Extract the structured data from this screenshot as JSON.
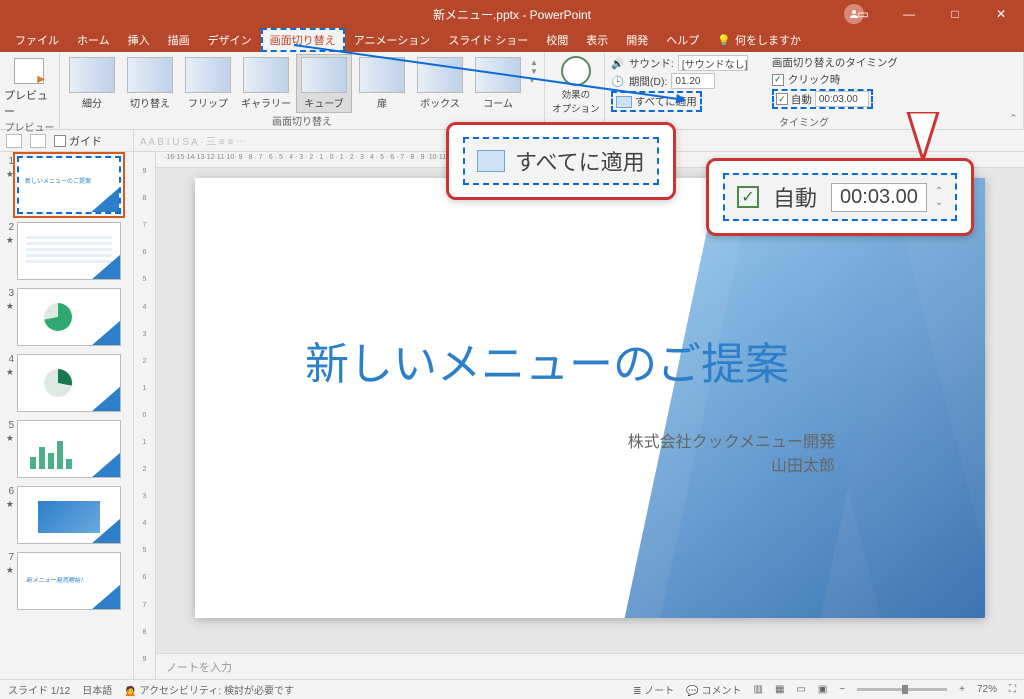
{
  "app": {
    "title": "新メニュー.pptx  -  PowerPoint"
  },
  "win": {
    "min": "—",
    "max": "□",
    "close": "✕",
    "rib": "▭"
  },
  "tabs": {
    "file": "ファイル",
    "home": "ホーム",
    "insert": "挿入",
    "draw": "描画",
    "design": "デザイン",
    "transitions": "画面切り替え",
    "animations": "アニメーション",
    "slideshow": "スライド ショー",
    "review": "校閲",
    "view": "表示",
    "dev": "開発",
    "help": "ヘルプ",
    "tell": "何をしますか"
  },
  "ribbon": {
    "preview": "プレビュー",
    "preview_grp": "プレビュー",
    "trans": {
      "items": [
        "細分",
        "切り替え",
        "フリップ",
        "ギャラリー",
        "キューブ",
        "扉",
        "ボックス",
        "コーム"
      ],
      "label": "画面切り替え"
    },
    "effect_options": "効果の\nオプション",
    "timing": {
      "sound_lbl": "サウンド:",
      "sound_val": "[サウンドなし]",
      "duration_lbl": "期間(D):",
      "duration_val": "01.20",
      "apply_all": "すべてに適用",
      "section_lbl": "画面切り替えのタイミング",
      "on_click": "クリック時",
      "auto_lbl": "自動",
      "auto_val": "00:03.00",
      "group_lbl": "タイミング"
    }
  },
  "viewbar": {
    "guide_lbl": "ガイド"
  },
  "format": {
    "text": "A  A  B  I  U  S  A  ·  三  ≡  ≡  ⋯"
  },
  "hruler_text": "·16·15·14·13·12·11·10· 9 · 8 · 7 · 6 · 5 · 4 · 3 · 2 · 1 · 0 · 1 · 2 · 3 · 4 · 5 · 6 · 7 · 8 · 9 ·10·11·12·13·14·15·16·",
  "vruler_vals": [
    "9",
    "8",
    "7",
    "6",
    "5",
    "4",
    "3",
    "2",
    "1",
    "0",
    "1",
    "2",
    "3",
    "4",
    "5",
    "6",
    "7",
    "8",
    "9"
  ],
  "thumbs": [
    {
      "n": "1",
      "star": "★",
      "txt": "新しいメニューのご提案"
    },
    {
      "n": "2",
      "star": "★",
      "txt": ""
    },
    {
      "n": "3",
      "star": "★",
      "txt": ""
    },
    {
      "n": "4",
      "star": "★",
      "txt": ""
    },
    {
      "n": "5",
      "star": "★",
      "txt": ""
    },
    {
      "n": "6",
      "star": "★",
      "txt": ""
    },
    {
      "n": "7",
      "star": "★",
      "txt": "新メニュー発売開始！"
    }
  ],
  "slide": {
    "title": "新しいメニューのご提案",
    "sub1": "株式会社クックメニュー開発",
    "sub2": "山田太郎"
  },
  "notes": "ノートを入力",
  "status": {
    "slide": "スライド 1/12",
    "lang": "日本語",
    "a11y": "アクセシビリティ: 検討が必要です",
    "notes_btn": "ノート",
    "comments": "コメント",
    "zoom_pct": "72%",
    "plus": "+",
    "minus": "−",
    "fit": "⛶"
  },
  "callouts": {
    "apply_all_big": "すべてに適用",
    "auto_lbl": "自動",
    "auto_val": "00:03.00"
  }
}
